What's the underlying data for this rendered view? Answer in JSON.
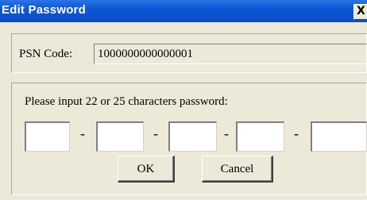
{
  "window": {
    "title": "Edit Password",
    "close_glyph": "X"
  },
  "psn": {
    "label": "PSN Code:",
    "value": "1000000000000001"
  },
  "password": {
    "prompt": "Please input 22 or 25 characters password:",
    "segments": [
      "",
      "",
      "",
      "",
      ""
    ],
    "separator": "-"
  },
  "buttons": {
    "ok": "OK",
    "cancel": "Cancel"
  },
  "colors": {
    "titlebar": "#0a4fc8",
    "dialog_bg": "#ece9d8",
    "title_text": "#ffffff"
  },
  "icons": {
    "close": "close-icon"
  }
}
